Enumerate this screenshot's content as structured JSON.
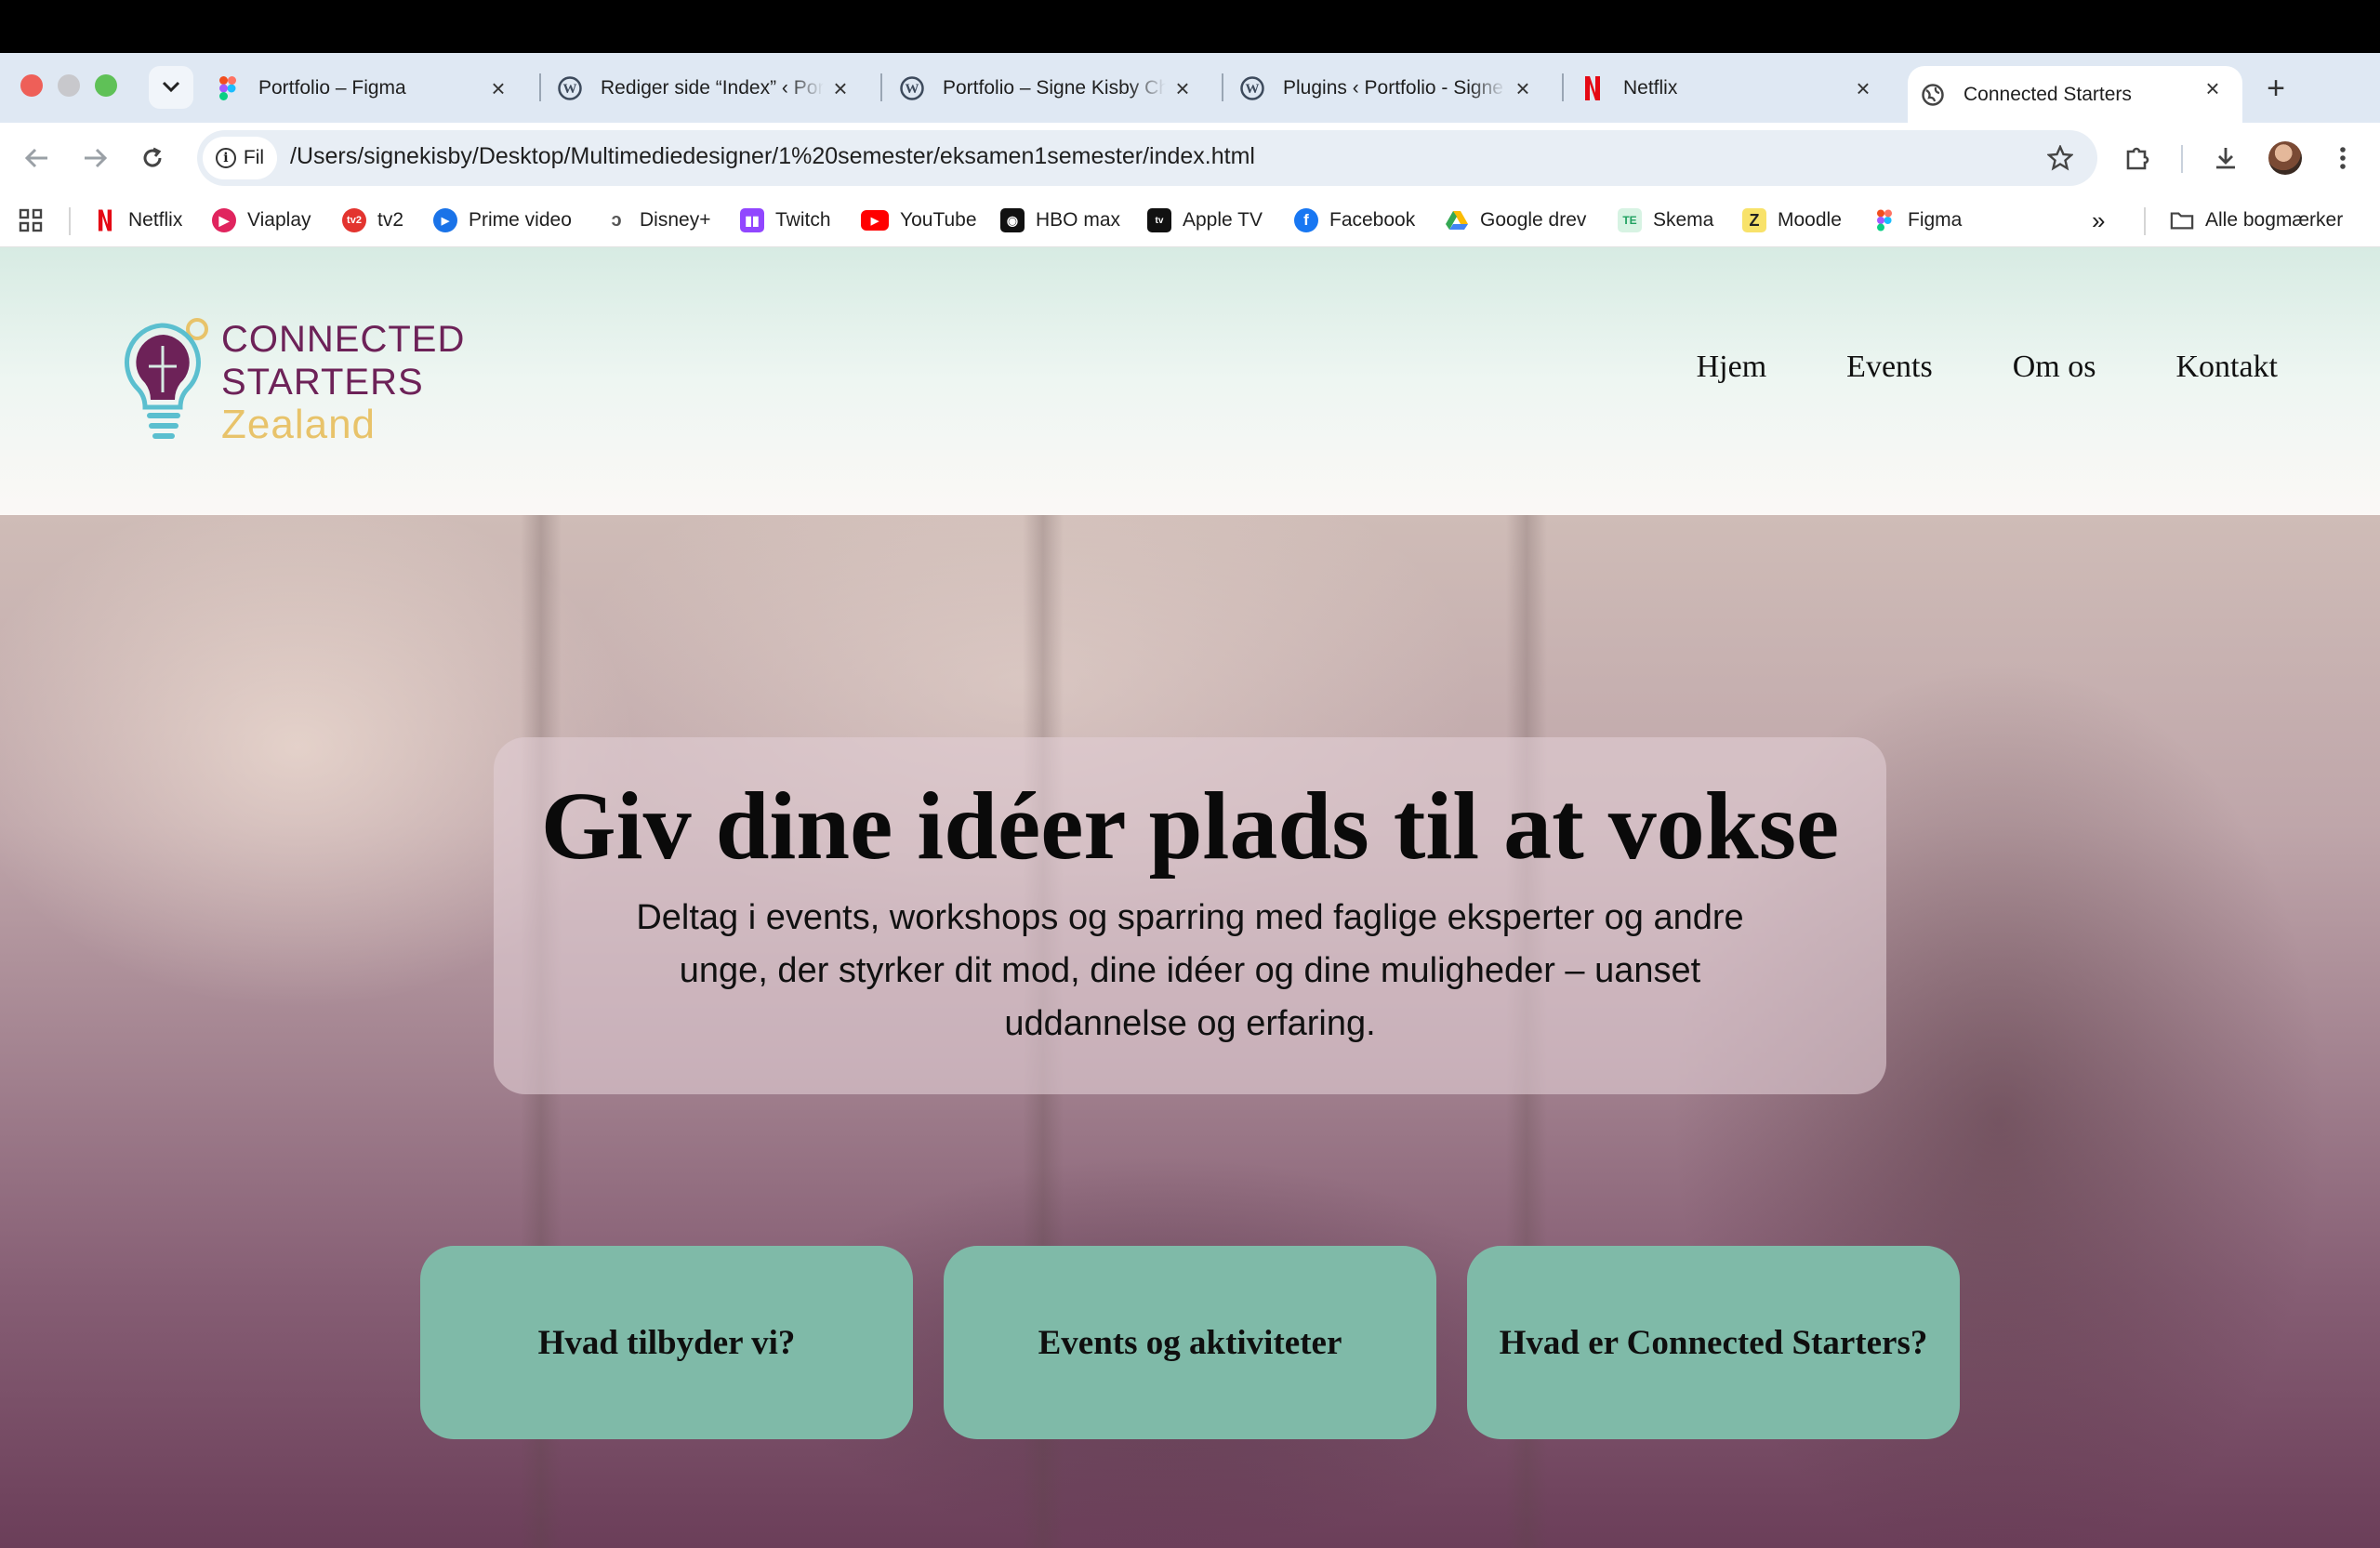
{
  "browser": {
    "tabs": [
      {
        "title": "Portfolio – Figma",
        "icon": "figma-icon"
      },
      {
        "title": "Rediger side “Index” ‹ Portfolio",
        "icon": "wordpress-icon"
      },
      {
        "title": "Portfolio – Signe Kisby Christensen",
        "icon": "wordpress-icon"
      },
      {
        "title": "Plugins ‹ Portfolio - Signe",
        "icon": "wordpress-icon"
      },
      {
        "title": "Netflix",
        "icon": "netflix-icon"
      },
      {
        "title": "Connected Starters",
        "icon": "globe-icon"
      }
    ],
    "active_tab": 5,
    "site_chip": "Fil",
    "url": "/Users/signekisby/Desktop/Multimediedesigner/1%20semester/eksamen1semester/index.html",
    "bookmarks": [
      {
        "label": "Netflix",
        "color": "#e50914",
        "icon": "netflix-icon"
      },
      {
        "label": "Viaplay",
        "color": "#e0245e",
        "icon": "viaplay-icon"
      },
      {
        "label": "tv2",
        "color": "#e3342f",
        "icon": "tv2-icon"
      },
      {
        "label": "Prime video",
        "color": "#1a73e8",
        "icon": "prime-video-icon"
      },
      {
        "label": "Disney+",
        "color": "#555555",
        "icon": "disney-icon"
      },
      {
        "label": "Twitch",
        "color": "#9146ff",
        "icon": "twitch-icon"
      },
      {
        "label": "YouTube",
        "color": "#ff0000",
        "icon": "youtube-icon"
      },
      {
        "label": "HBO max",
        "color": "#111111",
        "icon": "hbo-icon"
      },
      {
        "label": "Apple TV",
        "color": "#111111",
        "icon": "apple-tv-icon"
      },
      {
        "label": "Facebook",
        "color": "#1877f2",
        "icon": "facebook-icon"
      },
      {
        "label": "Google drev",
        "color": "#34a853",
        "icon": "google-drive-icon"
      },
      {
        "label": "Skema",
        "color": "#3dbb7a",
        "icon": "skema-icon"
      },
      {
        "label": "Moodle",
        "color": "#f5c518",
        "icon": "moodle-icon"
      },
      {
        "label": "Figma",
        "color": "#f24e1e",
        "icon": "figma-icon"
      }
    ],
    "all_bookmarks": "Alle bogmærker"
  },
  "site": {
    "logo": {
      "line1": "CONNECTED",
      "line2": "STARTERS",
      "line3": "Zealand"
    },
    "nav": [
      "Hjem",
      "Events",
      "Om os",
      "Kontakt"
    ],
    "hero": {
      "title": "Giv dine idéer plads til at vokse",
      "text": "Deltag i events, workshops og sparring med faglige eksperter og andre unge, der styrker dit mod, dine idéer og dine muligheder – uanset uddannelse og erfaring."
    },
    "buttons": [
      "Hvad tilbyder vi?",
      "Events og aktiviteter",
      "Hvad er Connected Starters?"
    ]
  },
  "colors": {
    "accent_green": "#7fbaa8",
    "logo_purple": "#6d2258",
    "logo_yellow": "#e8c36a"
  }
}
